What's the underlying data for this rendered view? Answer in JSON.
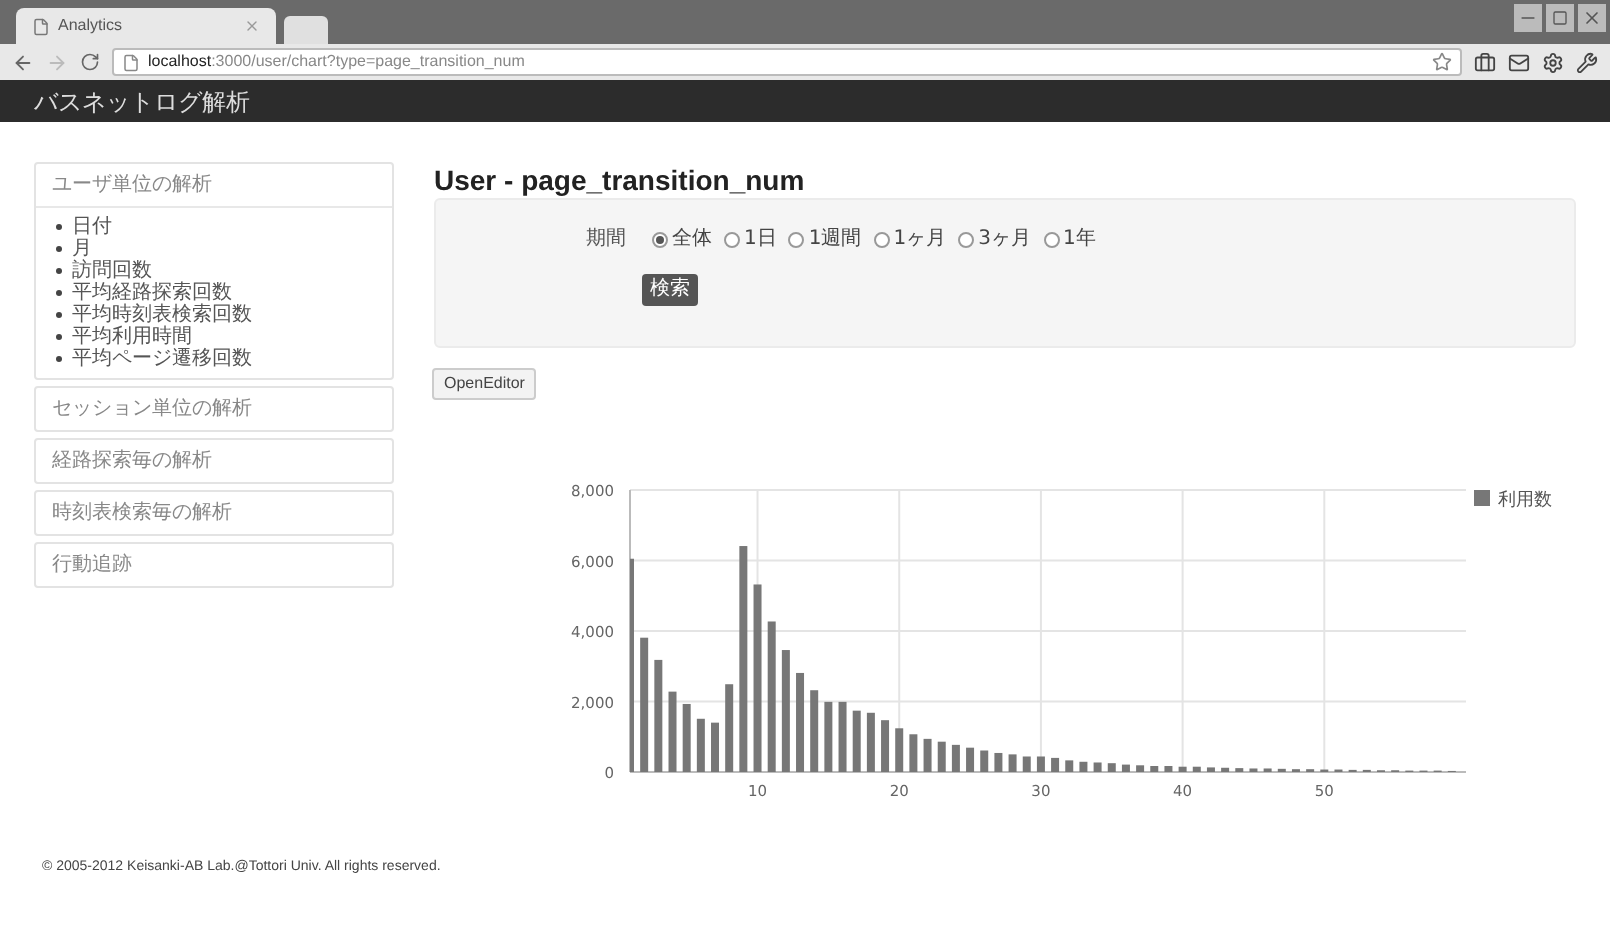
{
  "browser": {
    "tab_title": "Analytics",
    "url_host": "localhost",
    "url_path": ":3000/user/chart?type=page_transition_num"
  },
  "navbar": {
    "brand": "バスネットログ解析"
  },
  "sidebar": {
    "sections": [
      {
        "title": "ユーザ単位の解析",
        "expanded": true,
        "items": [
          "日付",
          "月",
          "訪問回数",
          "平均経路探索回数",
          "平均時刻表検索回数",
          "平均利用時間",
          "平均ページ遷移回数"
        ]
      },
      {
        "title": "セッション単位の解析",
        "expanded": false
      },
      {
        "title": "経路探索毎の解析",
        "expanded": false
      },
      {
        "title": "時刻表検索毎の解析",
        "expanded": false
      },
      {
        "title": "行動追跡",
        "expanded": false
      }
    ]
  },
  "main": {
    "title": "User - page_transition_num",
    "filter": {
      "label": "期間",
      "options": [
        {
          "label": "全体",
          "selected": true
        },
        {
          "label": "1日",
          "selected": false
        },
        {
          "label": "1週間",
          "selected": false
        },
        {
          "label": "1ヶ月",
          "selected": false
        },
        {
          "label": "3ヶ月",
          "selected": false
        },
        {
          "label": "1年",
          "selected": false
        }
      ],
      "button": "検索"
    },
    "open_editor_button": "OpenEditor",
    "chart_data": {
      "type": "bar",
      "x": [
        1,
        2,
        3,
        4,
        5,
        6,
        7,
        8,
        9,
        10,
        11,
        12,
        13,
        14,
        15,
        16,
        17,
        18,
        19,
        20,
        21,
        22,
        23,
        24,
        25,
        26,
        27,
        28,
        29,
        30,
        31,
        32,
        33,
        34,
        35,
        36,
        37,
        38,
        39,
        40,
        41,
        42,
        43,
        44,
        45,
        46,
        47,
        48,
        49,
        50,
        51,
        52,
        53,
        54,
        55,
        56,
        57,
        58,
        59
      ],
      "series": [
        {
          "name": "利用数",
          "color": "#777777",
          "values": [
            6050,
            3810,
            3180,
            2280,
            1930,
            1510,
            1400,
            2490,
            6410,
            5320,
            4270,
            3460,
            2810,
            2320,
            1990,
            1990,
            1740,
            1680,
            1470,
            1240,
            1070,
            940,
            860,
            770,
            690,
            610,
            540,
            500,
            440,
            440,
            400,
            330,
            290,
            270,
            250,
            210,
            190,
            170,
            170,
            150,
            150,
            130,
            120,
            110,
            100,
            100,
            90,
            80,
            80,
            70,
            70,
            60,
            60,
            50,
            50,
            40,
            40,
            40,
            30
          ]
        }
      ],
      "grid": true,
      "xlim": [
        1,
        60
      ],
      "ylim": [
        0,
        8000
      ],
      "xticks": [
        10,
        20,
        30,
        40,
        50
      ],
      "yticks": [
        {
          "value": 0,
          "label": "0"
        },
        {
          "value": 2000,
          "label": "2,000"
        },
        {
          "value": 4000,
          "label": "4,000"
        },
        {
          "value": 6000,
          "label": "6,000"
        },
        {
          "value": 8000,
          "label": "8,000"
        }
      ]
    }
  },
  "footer": "© 2005-2012 Keisanki-AB Lab.@Tottori Univ. All rights reserved."
}
